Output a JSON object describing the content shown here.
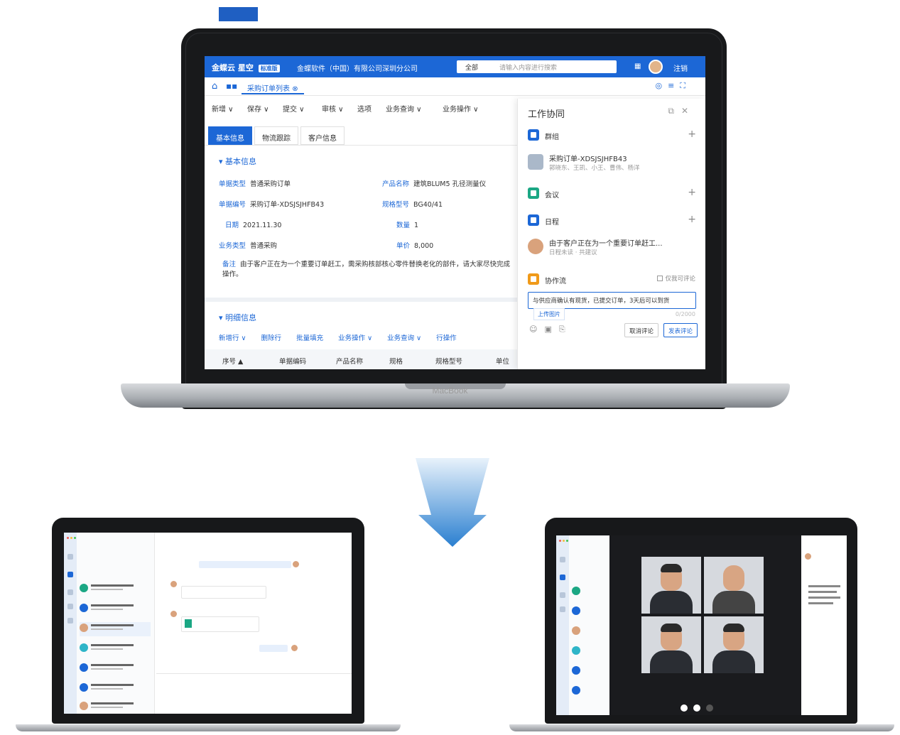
{
  "main": {
    "topbar": {
      "logo": "金蝶云 星空",
      "edition": "标准版",
      "company": "金蝶软件（中国）有限公司深圳分公司",
      "search_scope": "全部",
      "search_placeholder": "请输入内容进行搜索",
      "grid_icon": "apps-grid-icon",
      "logout": "注销"
    },
    "tab": "采购订单列表",
    "toolbar": [
      "新增 ∨",
      "保存 ∨",
      "提交 ∨",
      "审核 ∨",
      "选项",
      "业务查询 ∨",
      "业务操作 ∨"
    ],
    "subtabs": [
      "基本信息",
      "物流跟踪",
      "客户信息"
    ],
    "basic_section": "基本信息",
    "fields": {
      "doc_type_label": "单据类型",
      "doc_type": "普通采购订单",
      "doc_no_label": "单据编号",
      "doc_no": "采购订单-XDSJSJHFB43",
      "date_label": "日期",
      "date": "2021.11.30",
      "biz_type_label": "业务类型",
      "biz_type": "普通采购",
      "product_label": "产品名称",
      "product": "建筑BLUM5 孔径测量仪",
      "spec_label": "规格型号",
      "spec": "BG40/41",
      "qty_label": "数量",
      "qty": "1",
      "price_label": "单价",
      "price": "8,000",
      "remark_label": "备注",
      "remark": "由于客户正在为一个重要订单赶工，需采购核部核心零件替换老化的部件，请大家尽快完成操作。"
    },
    "detail_section": "明细信息",
    "detail_ops": [
      "新增行 ∨",
      "删除行",
      "批量填充",
      "业务操作 ∨",
      "业务查询 ∨",
      "行操作"
    ],
    "table_headers": [
      "序号 ▲",
      "单据编码",
      "产品名称",
      "规格",
      "规格型号",
      "单位"
    ],
    "brand": "MacBook"
  },
  "panel": {
    "title": "工作协同",
    "group_label": "群组",
    "group_item_title": "采购订单-XDSJSJHFB43",
    "group_item_sub": "郭晓东、王凯、小王、曹伟、杨洋",
    "meeting_label": "会议",
    "schedule_label": "日程",
    "schedule_item_title": "由于客户正在为一个重要订单赶工...",
    "schedule_item_sub": "日程未读 · 共建议",
    "collab_label": "协作流",
    "only_me": "仅我可评论",
    "comment_text": "与供应商确认有现货，已提交订单，3天后可以到货",
    "upload_tip": "上传图片",
    "counter": "0/2000",
    "btn_cancel": "取消评论",
    "btn_submit": "发表评论"
  },
  "colors": {
    "brand_blue": "#1c67d6",
    "green": "#1ba784",
    "orange": "#f09a1a"
  }
}
